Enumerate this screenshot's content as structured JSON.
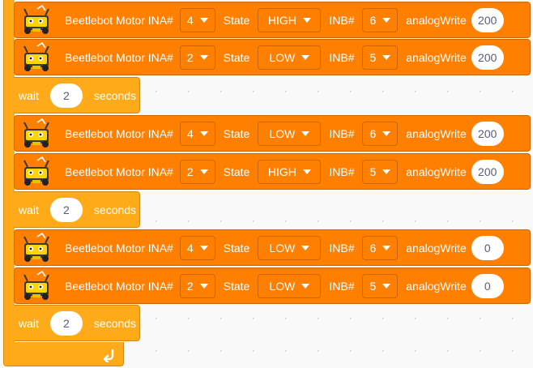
{
  "blocks": [
    {
      "type": "motor",
      "text": "Beetlebot Motor INA#",
      "ina": "4",
      "state_label": "State",
      "state": "HIGH",
      "inb_label": "INB#",
      "inb": "6",
      "analog_label": "analogWrite",
      "analog": "200"
    },
    {
      "type": "motor",
      "text": "Beetlebot Motor INA#",
      "ina": "2",
      "state_label": "State",
      "state": "LOW",
      "inb_label": "INB#",
      "inb": "5",
      "analog_label": "analogWrite",
      "analog": "200"
    },
    {
      "type": "wait",
      "label": "wait",
      "value": "2",
      "unit": "seconds"
    },
    {
      "type": "motor",
      "text": "Beetlebot Motor INA#",
      "ina": "4",
      "state_label": "State",
      "state": "LOW",
      "inb_label": "INB#",
      "inb": "6",
      "analog_label": "analogWrite",
      "analog": "200"
    },
    {
      "type": "motor",
      "text": "Beetlebot Motor INA#",
      "ina": "2",
      "state_label": "State",
      "state": "HIGH",
      "inb_label": "INB#",
      "inb": "5",
      "analog_label": "analogWrite",
      "analog": "200"
    },
    {
      "type": "wait",
      "label": "wait",
      "value": "2",
      "unit": "seconds"
    },
    {
      "type": "motor",
      "text": "Beetlebot Motor INA#",
      "ina": "4",
      "state_label": "State",
      "state": "LOW",
      "inb_label": "INB#",
      "inb": "6",
      "analog_label": "analogWrite",
      "analog": "0"
    },
    {
      "type": "motor",
      "text": "Beetlebot Motor INA#",
      "ina": "2",
      "state_label": "State",
      "state": "LOW",
      "inb_label": "INB#",
      "inb": "5",
      "analog_label": "analogWrite",
      "analog": "0"
    },
    {
      "type": "wait",
      "label": "wait",
      "value": "2",
      "unit": "seconds"
    }
  ],
  "icons": {
    "block_icon": "beetlebot-icon",
    "loop_end": "loop-arrow-icon"
  },
  "colors": {
    "motor": "#ff7f00",
    "control": "#ffab19",
    "canvas": "#f9f9f9",
    "input_text": "#575e75"
  }
}
